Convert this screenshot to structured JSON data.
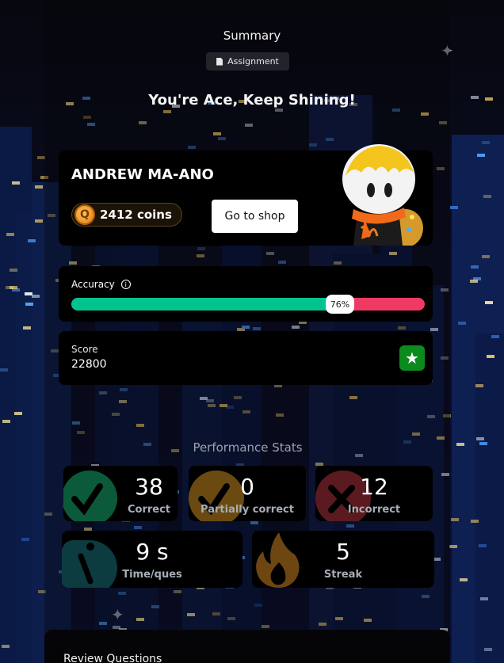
{
  "header": {
    "title": "Summary",
    "badge_label": "Assignment",
    "headline": "You're Ace, Keep Shining!"
  },
  "player": {
    "name": "ANDREW MA-ANO",
    "coins": "2412 coins",
    "shop_label": "Go to shop"
  },
  "accuracy": {
    "label": "Accuracy",
    "percent": 76,
    "percent_text": "76%"
  },
  "score": {
    "label": "Score",
    "value": "22800"
  },
  "performance": {
    "title": "Performance Stats",
    "correct": {
      "value": "38",
      "label": "Correct"
    },
    "partial": {
      "value": "0",
      "label": "Partially correct"
    },
    "incorrect": {
      "value": "12",
      "label": "Incorrect"
    },
    "time": {
      "value": "9 s",
      "label": "Time/ques"
    },
    "streak": {
      "value": "5",
      "label": "Streak"
    }
  },
  "review": {
    "title": "Review Questions"
  },
  "colors": {
    "correct": "#00c48c",
    "incorrect": "#ef3b63",
    "score_badge": "#0d8a1e"
  },
  "icons": {
    "badge": "document-icon",
    "coins": "coin-icon",
    "accuracy": "info-icon",
    "score": "star-icon",
    "correct": "checkmark-icon",
    "partial": "checkmark-icon",
    "incorrect": "x-icon",
    "time": "stopwatch-icon",
    "streak": "flame-icon"
  }
}
